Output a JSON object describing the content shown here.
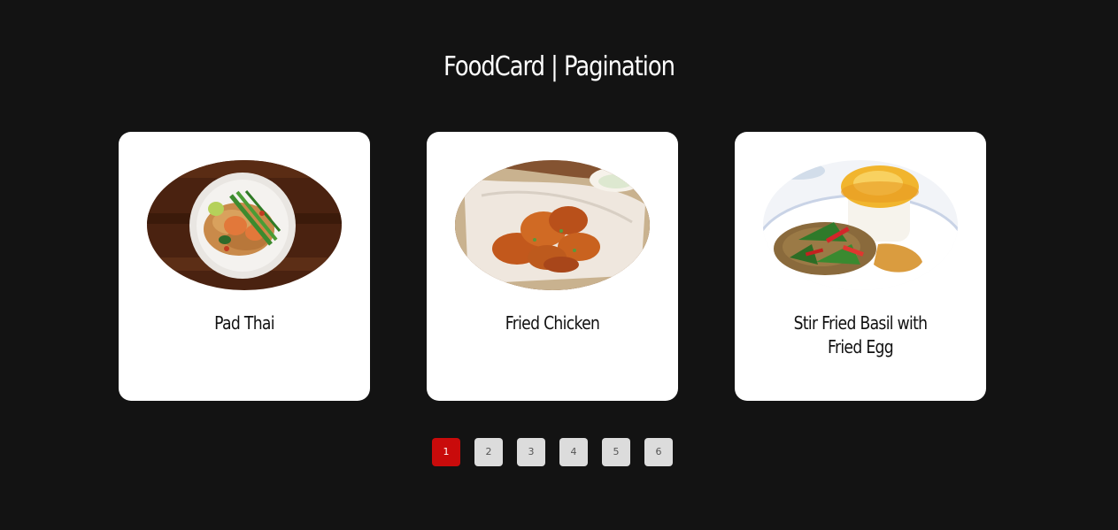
{
  "header": {
    "title": "FoodCard | Pagination"
  },
  "cards": [
    {
      "name": "Pad Thai",
      "image": "pad-thai-dish"
    },
    {
      "name": "Fried Chicken",
      "image": "fried-chicken-dish"
    },
    {
      "name": "Stir Fried Basil with Fried Egg",
      "image": "basil-stir-fry-dish"
    }
  ],
  "pagination": {
    "pages": [
      "1",
      "2",
      "3",
      "4",
      "5",
      "6"
    ],
    "active": "1",
    "active_color": "#c90b0b",
    "inactive_color": "#dcdcdc"
  },
  "colors": {
    "background": "#131313",
    "card": "#ffffff"
  }
}
